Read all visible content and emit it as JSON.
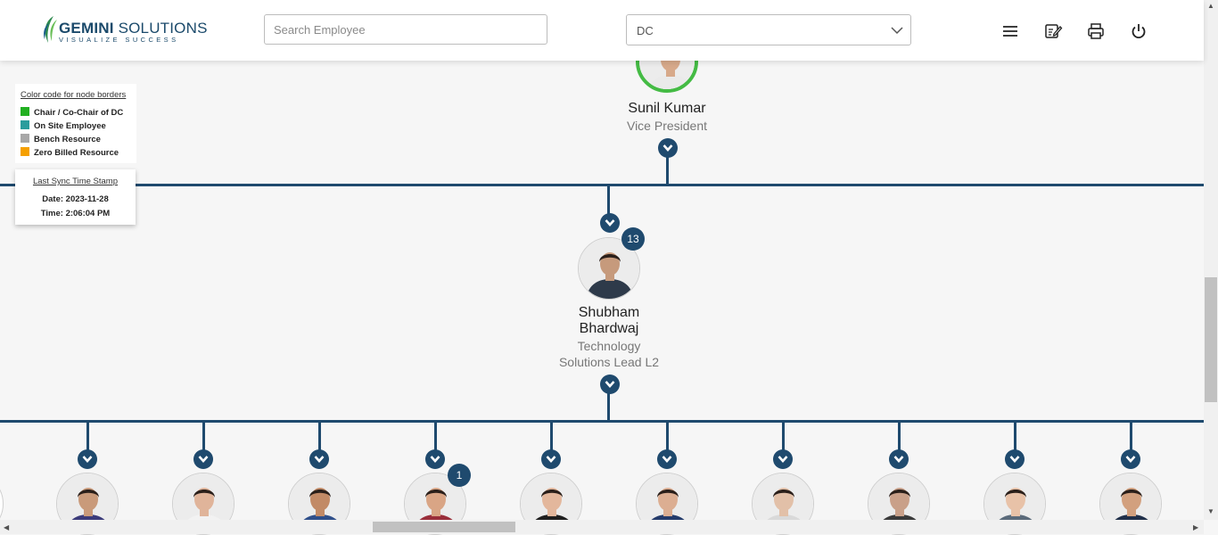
{
  "app": {
    "logo_text_bold": "GEMINI",
    "logo_text_regular": " SOLUTIONS",
    "logo_tagline": "VISUALIZE SUCCESS"
  },
  "search": {
    "placeholder": "Search Employee",
    "value": ""
  },
  "department_select": {
    "selected": "DC"
  },
  "header_icons": [
    "menu-icon",
    "edit-note-icon",
    "print-icon",
    "power-icon"
  ],
  "legend": {
    "title": "Color code for node borders",
    "items": [
      {
        "label": "Chair / Co-Chair of DC",
        "color": "#22b022"
      },
      {
        "label": "On Site Employee",
        "color": "#2a9d9d"
      },
      {
        "label": "Bench Resource",
        "color": "#a8a8a8"
      },
      {
        "label": "Zero Billed Resource",
        "color": "#f5a000"
      }
    ]
  },
  "sync": {
    "title": "Last Sync Time Stamp",
    "date": "Date: 2023-11-28",
    "time": "Time: 2:06:04 PM"
  },
  "root_node": {
    "name": "Sunil Kumar",
    "designation": "Vice President",
    "border_color": "#44bb44"
  },
  "lead_node": {
    "name_line1": "Shubham",
    "name_line2": "Bhardwaj",
    "designation_line1": "Technology",
    "designation_line2": "Solutions Lead L2",
    "reports_count": "13"
  },
  "children": [
    {
      "badge": ""
    },
    {
      "badge": ""
    },
    {
      "badge": ""
    },
    {
      "badge": "1"
    },
    {
      "badge": ""
    },
    {
      "badge": ""
    },
    {
      "badge": ""
    },
    {
      "badge": ""
    },
    {
      "badge": ""
    },
    {
      "badge": ""
    }
  ]
}
